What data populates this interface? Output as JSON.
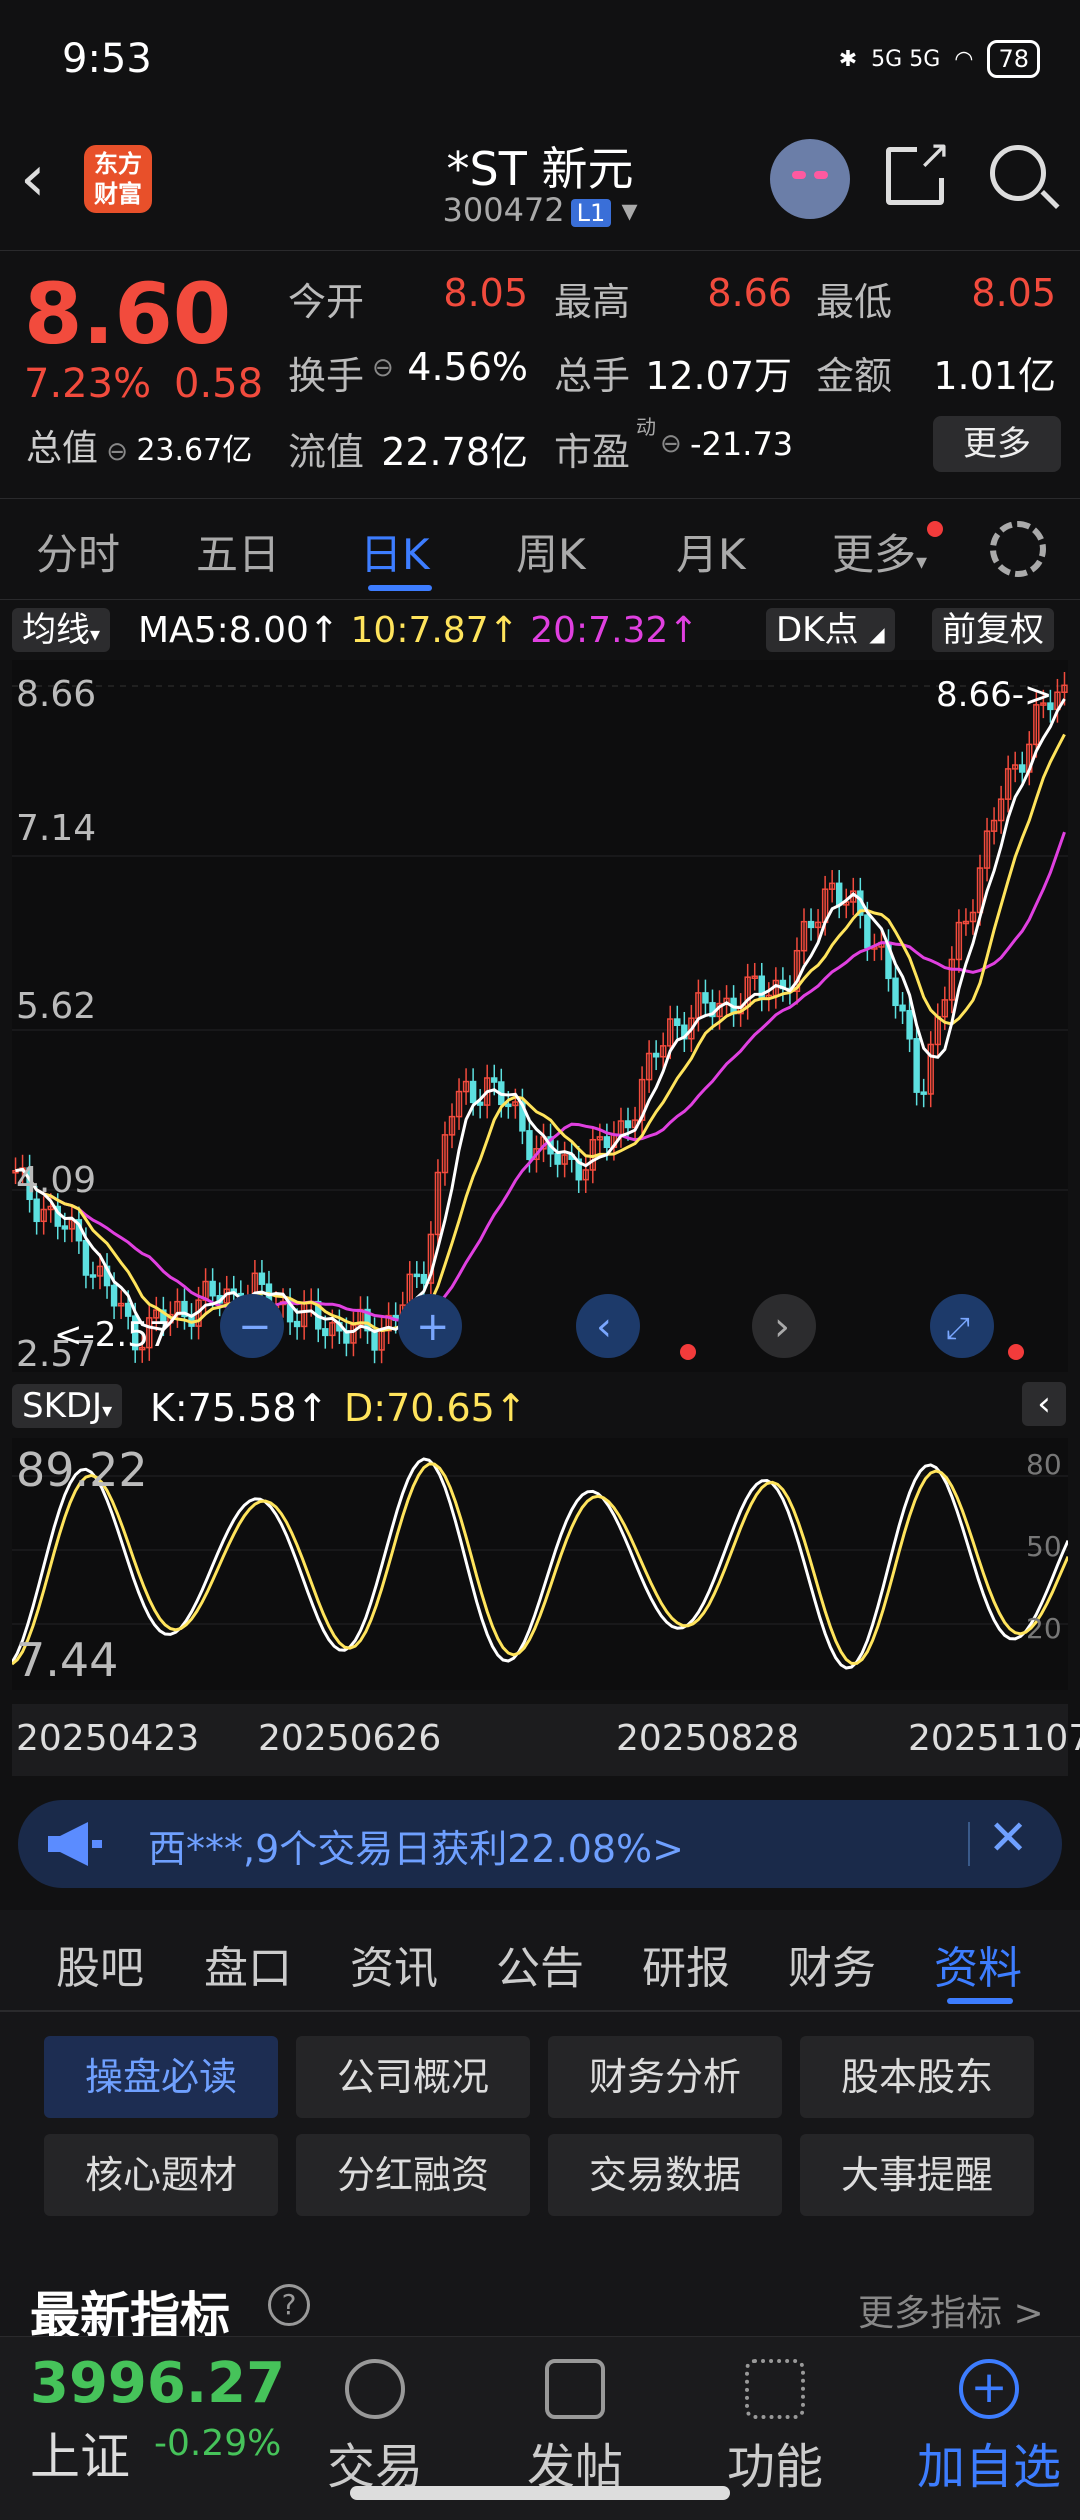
{
  "status_bar": {
    "time": "9:53",
    "network": "5G 5G",
    "battery": "78"
  },
  "nav": {
    "logo_text": "东方财富",
    "stock_name": "*ST 新元",
    "stock_code": "300472",
    "level": "L1"
  },
  "quote": {
    "price": "8.60",
    "change_pct": "7.23%",
    "change": "0.58",
    "rows": [
      [
        {
          "label": "今开",
          "value": "8.05",
          "red": true
        },
        {
          "label": "最高",
          "value": "8.66",
          "red": true
        },
        {
          "label": "最低",
          "value": "8.05",
          "red": true
        }
      ],
      [
        {
          "label": "换手",
          "value": "4.56%"
        },
        {
          "label": "总手",
          "value": "12.07万"
        },
        {
          "label": "金额",
          "value": "1.01亿"
        }
      ],
      [
        {
          "label": "流值",
          "value": "22.78亿"
        },
        {
          "label": "市盈",
          "value": "-21.73"
        }
      ]
    ],
    "market_cap_label": "总值",
    "market_cap_value": "23.67亿",
    "pe_tag": "动",
    "more": "更多"
  },
  "period_tabs": [
    "分时",
    "五日",
    "日K",
    "周K",
    "月K",
    "更多"
  ],
  "chart_header": {
    "indicator": "均线",
    "ma5": "MA5:8.00",
    "ma10": "10:7.87",
    "ma20": "20:7.32",
    "dk": "DK点",
    "adjust": "前复权",
    "colors": {
      "ma5": "#ffffff",
      "ma10": "#ffe45c",
      "ma20": "#e040e0",
      "up": "#f24b3d",
      "down": "#5de0e0"
    }
  },
  "chart_data": {
    "type": "candlestick",
    "y_ticks": [
      "8.66",
      "7.14",
      "5.62",
      "4.09",
      "2.57"
    ],
    "high_label": "8.66->",
    "low_label": "<-2.57",
    "dates": [
      "20250423",
      "20250626",
      "20250828",
      "20251107"
    ],
    "kdj": {
      "indicator": "SKDJ",
      "k": "K:75.58",
      "d": "D:70.65",
      "y_ticks_left": [
        "89.22",
        "7.44"
      ],
      "y_ticks_right": [
        "80",
        "50",
        "20"
      ]
    }
  },
  "banner": {
    "text": "西***,9个交易日获利22.08%>"
  },
  "info_tabs": [
    "股吧",
    "盘口",
    "资讯",
    "公告",
    "研报",
    "财务",
    "资料"
  ],
  "info_buttons": [
    "操盘必读",
    "公司概况",
    "财务分析",
    "股本股东",
    "核心题材",
    "分红融资",
    "交易数据",
    "大事提醒"
  ],
  "latest": {
    "title": "最新指标",
    "more": "更多指标 >"
  },
  "bottom": {
    "index_value": "3996.27",
    "index_name": "上证",
    "index_pct": "-0.29%",
    "nav": [
      "交易",
      "发帖",
      "功能",
      "加自选"
    ]
  }
}
